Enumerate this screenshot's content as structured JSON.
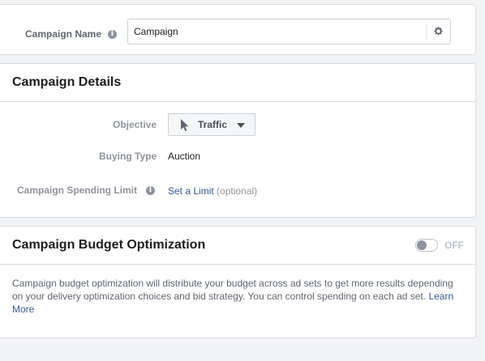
{
  "campaign_name": {
    "label": "Campaign Name",
    "info_icon": "info-icon",
    "input_value": "Campaign",
    "settings_icon": "gear-icon"
  },
  "details": {
    "title": "Campaign Details",
    "objective_label": "Objective",
    "objective_value": "Traffic",
    "objective_icon": "cursor-icon",
    "buying_type_label": "Buying Type",
    "buying_type_value": "Auction",
    "spending_limit_label": "Campaign Spending Limit",
    "spending_limit_link": "Set a Limit",
    "spending_limit_note": "(optional)"
  },
  "budget": {
    "title": "Campaign Budget Optimization",
    "toggle_state": "OFF",
    "description": "Campaign budget optimization will distribute your budget across ad sets to get more results depending on your delivery optimization choices and bid strategy. You can control spending on each ad set.",
    "learn_more": "Learn More"
  },
  "colors": {
    "link": "#365899",
    "label_gray": "#90949c",
    "page_bg": "#f2f3f5"
  }
}
